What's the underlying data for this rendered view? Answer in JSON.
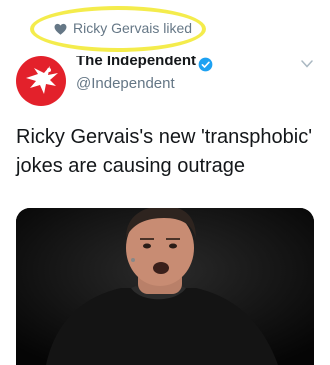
{
  "social_context": {
    "icon": "heart-icon",
    "text": "Ricky Gervais liked",
    "highlight_color": "#f4ec4c"
  },
  "tweet": {
    "author": {
      "name": "The Independent",
      "handle": "@Independent",
      "avatar_icon": "eagle-logo-icon",
      "avatar_color": "#e3212b",
      "verified": true,
      "verified_color": "#1da1f2"
    },
    "menu_icon": "chevron-down-icon",
    "text": "Ricky Gervais's new 'transphobic' jokes are causing outrage",
    "media": {
      "type": "photo",
      "description_icon": "comedian-photo"
    }
  },
  "colors": {
    "text": "#14171a",
    "muted": "#657786",
    "background": "#ffffff"
  }
}
